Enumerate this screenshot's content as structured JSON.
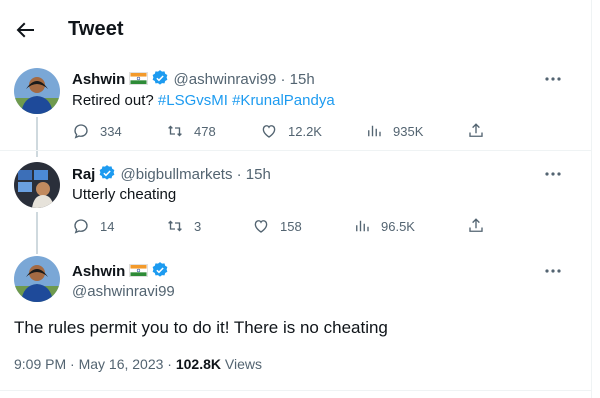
{
  "header": {
    "title": "Tweet",
    "back_icon": "arrow-left-icon"
  },
  "colors": {
    "accent": "#1d9bf0",
    "muted": "#536471",
    "text": "#0f1419",
    "verified": "#1d9bf0"
  },
  "replies": [
    {
      "name": "Ashwin",
      "flag": "india-flag-icon",
      "handle": "@ashwinravi99",
      "time": "15h",
      "text_plain": "Retired out?",
      "hashtags": [
        "#LSGvsMI",
        "#KrunalPandya"
      ],
      "actions": {
        "replies": "334",
        "retweets": "478",
        "likes": "12.2K",
        "views": "935K"
      }
    },
    {
      "name": "Raj",
      "handle": "@bigbullmarkets",
      "time": "15h",
      "text_plain": "Utterly cheating",
      "actions": {
        "replies": "14",
        "retweets": "3",
        "likes": "158",
        "views": "96.5K"
      }
    }
  ],
  "main": {
    "name": "Ashwin",
    "flag": "india-flag-icon",
    "handle": "@ashwinravi99",
    "text": "The rules permit you to do it! There is no cheating",
    "timestamp": "9:09 PM · May 16, 2023 · ",
    "views_count": "102.8K",
    "views_label": " Views"
  },
  "separator": "·"
}
